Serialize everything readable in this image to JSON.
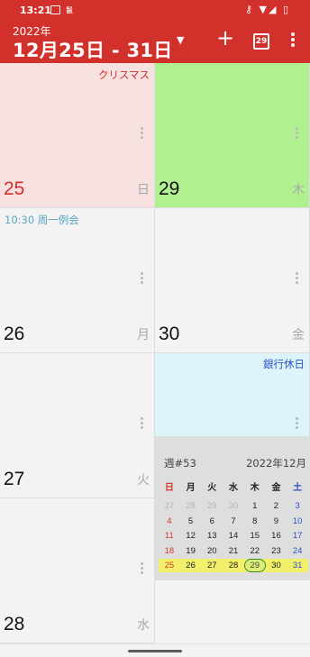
{
  "status_bar": {
    "time": "13:21",
    "notification_text": "鬣",
    "right_icons": "⚷ ▼◢ ▯"
  },
  "app_bar": {
    "year": "2022年",
    "range": "12月25日 - 31日",
    "today_badge": "29",
    "colors": {
      "background": "#d2302b",
      "text": "#ffffff"
    },
    "icons": [
      "chevron-down-icon",
      "add-icon",
      "today-calendar-icon",
      "more-vert-icon"
    ]
  },
  "days": [
    {
      "day": "25",
      "dow": "日",
      "bg": "#f7e1e0",
      "day_color": "#d2302b",
      "event": "クリスマス",
      "event_color": "#d2302b"
    },
    {
      "day": "29",
      "dow": "木",
      "bg": "#b1f090",
      "day_color": "#111111",
      "event": "",
      "event_color": ""
    },
    {
      "day": "26",
      "dow": "月",
      "bg": "#f3f3f3",
      "day_color": "#111111",
      "event": "10:30 周一例会",
      "event_color": "#5aa6c6"
    },
    {
      "day": "30",
      "dow": "金",
      "bg": "#f3f3f3",
      "day_color": "#111111",
      "event": "",
      "event_color": ""
    },
    {
      "day": "27",
      "dow": "火",
      "bg": "#f3f3f3",
      "day_color": "#111111",
      "event": "",
      "event_color": ""
    },
    {
      "day": "31",
      "dow": "土",
      "bg": "#ddf5fa",
      "day_color": "#2a52c8",
      "event": "銀行休日",
      "event_color": "#2a52c8"
    },
    {
      "day": "28",
      "dow": "水",
      "bg": "#f3f3f3",
      "day_color": "#111111",
      "event": "",
      "event_color": ""
    }
  ],
  "mini_calendar": {
    "week_label": "週#53",
    "month_label": "2022年12月",
    "headers": [
      "日",
      "月",
      "火",
      "水",
      "木",
      "金",
      "土"
    ],
    "weeks": [
      [
        "27",
        "28",
        "29",
        "30",
        "1",
        "2",
        "3"
      ],
      [
        "4",
        "5",
        "6",
        "7",
        "8",
        "9",
        "10"
      ],
      [
        "11",
        "12",
        "13",
        "14",
        "15",
        "16",
        "17"
      ],
      [
        "18",
        "19",
        "20",
        "21",
        "22",
        "23",
        "24"
      ],
      [
        "25",
        "26",
        "27",
        "28",
        "29",
        "30",
        "31"
      ]
    ],
    "today": "29",
    "highlight_color": "#f2f06a"
  }
}
